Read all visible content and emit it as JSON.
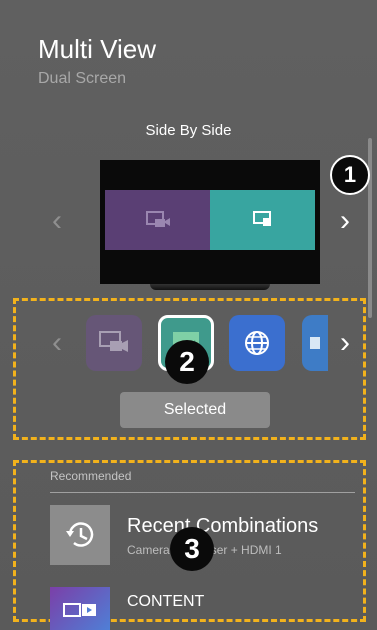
{
  "header": {
    "title": "Multi View",
    "subtitle": "Dual Screen"
  },
  "layout_picker": {
    "mode_label": "Side By Side",
    "prev_icon": "chevron-left",
    "next_icon": "chevron-right"
  },
  "app_picker": {
    "selected_label": "Selected",
    "prev_icon": "chevron-left",
    "next_icon": "chevron-right"
  },
  "recommended": {
    "header": "Recommended",
    "items": [
      {
        "title": "Recent Combinations",
        "subtitle": "Camera + Browser + HDMI 1",
        "icon": "history-icon"
      },
      {
        "title": "CONTENT",
        "icon": "content-icon"
      }
    ]
  },
  "callouts": [
    "1",
    "2",
    "3"
  ],
  "colors": {
    "highlight_border": "#f2b21c",
    "left_screen": "#5a3f74",
    "right_screen": "#38a5a0"
  }
}
